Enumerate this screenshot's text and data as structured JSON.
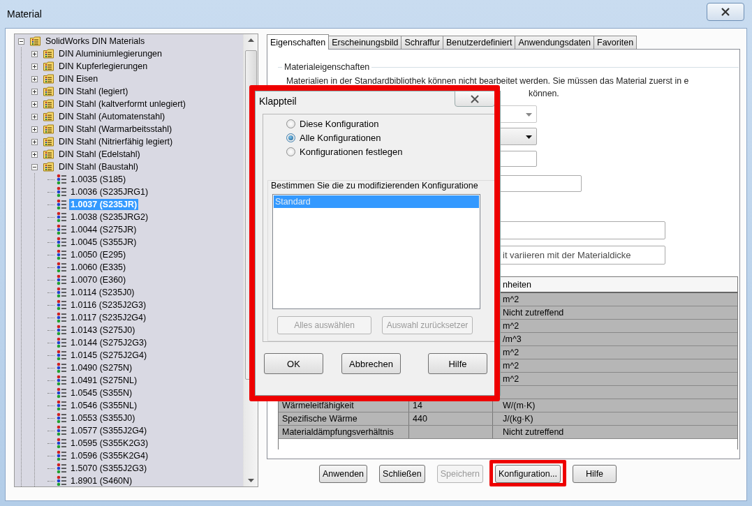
{
  "window": {
    "title": "Material"
  },
  "tree": [
    {
      "label": "SolidWorks DIN Materials",
      "kind": "library",
      "expanded": true,
      "selected": false,
      "children": [
        {
          "label": "DIN Aluminiumlegierungen",
          "kind": "folder",
          "expanded": false,
          "selected": false
        },
        {
          "label": "DIN Kupferlegierungen",
          "kind": "folder",
          "expanded": false,
          "selected": false
        },
        {
          "label": "DIN Eisen",
          "kind": "folder",
          "expanded": false,
          "selected": false
        },
        {
          "label": "DIN Stahl (legiert)",
          "kind": "folder",
          "expanded": false,
          "selected": false
        },
        {
          "label": "DIN Stahl (kaltverformt unlegiert)",
          "kind": "folder",
          "expanded": false,
          "selected": false
        },
        {
          "label": "DIN Stahl (Automatenstahl)",
          "kind": "folder",
          "expanded": false,
          "selected": false
        },
        {
          "label": "DIN Stahl (Warmarbeitsstahl)",
          "kind": "folder",
          "expanded": false,
          "selected": false
        },
        {
          "label": "DIN Stahl (Nitrierfähig legiert)",
          "kind": "folder",
          "expanded": false,
          "selected": false
        },
        {
          "label": "DIN Stahl (Edelstahl)",
          "kind": "folder",
          "expanded": false,
          "selected": false
        },
        {
          "label": "DIN Stahl (Baustahl)",
          "kind": "folder",
          "expanded": true,
          "selected": false,
          "children": [
            {
              "label": "1.0035 (S185)",
              "kind": "material",
              "selected": false
            },
            {
              "label": "1.0036 (S235JRG1)",
              "kind": "material",
              "selected": false
            },
            {
              "label": "1.0037 (S235JR)",
              "kind": "material",
              "selected": true
            },
            {
              "label": "1.0038 (S235JRG2)",
              "kind": "material",
              "selected": false
            },
            {
              "label": "1.0044 (S275JR)",
              "kind": "material",
              "selected": false
            },
            {
              "label": "1.0045 (S355JR)",
              "kind": "material",
              "selected": false
            },
            {
              "label": "1.0050 (E295)",
              "kind": "material",
              "selected": false
            },
            {
              "label": "1.0060 (E335)",
              "kind": "material",
              "selected": false
            },
            {
              "label": "1.0070 (E360)",
              "kind": "material",
              "selected": false
            },
            {
              "label": "1.0114 (S235J0)",
              "kind": "material",
              "selected": false
            },
            {
              "label": "1.0116 (S235J2G3)",
              "kind": "material",
              "selected": false
            },
            {
              "label": "1.0117 (S235J2G4)",
              "kind": "material",
              "selected": false
            },
            {
              "label": "1.0143 (S275J0)",
              "kind": "material",
              "selected": false
            },
            {
              "label": "1.0144 (S275J2G3)",
              "kind": "material",
              "selected": false
            },
            {
              "label": "1.0145 (S275J2G4)",
              "kind": "material",
              "selected": false
            },
            {
              "label": "1.0490 (S275N)",
              "kind": "material",
              "selected": false
            },
            {
              "label": "1.0491 (S275NL)",
              "kind": "material",
              "selected": false
            },
            {
              "label": "1.0545 (S355N)",
              "kind": "material",
              "selected": false
            },
            {
              "label": "1.0546 (S355NL)",
              "kind": "material",
              "selected": false
            },
            {
              "label": "1.0553 (S355J0)",
              "kind": "material",
              "selected": false
            },
            {
              "label": "1.0577 (S355J2G4)",
              "kind": "material",
              "selected": false
            },
            {
              "label": "1.0595 (S355K2G3)",
              "kind": "material",
              "selected": false
            },
            {
              "label": "1.0596 (S355K2G4)",
              "kind": "material",
              "selected": false
            },
            {
              "label": "1.5070 (S355J2G3)",
              "kind": "material",
              "selected": false
            },
            {
              "label": "1.8901 (S460N)",
              "kind": "material",
              "selected": false
            }
          ]
        }
      ]
    }
  ],
  "tabs": [
    {
      "label": "Eigenschaften",
      "selected": true
    },
    {
      "label": "Erscheinungsbild",
      "selected": false
    },
    {
      "label": "Schraffur",
      "selected": false
    },
    {
      "label": "Benutzerdefiniert",
      "selected": false
    },
    {
      "label": "Anwendungsdaten",
      "selected": false
    },
    {
      "label": "Favoriten",
      "selected": false
    }
  ],
  "properties": {
    "group_title": "Materialeigenschaften",
    "notice_lines": [
      "Materialien in der Standardbibliothek können nicht bearbeitet werden. Sie müssen das Material zuerst in e",
      "können."
    ],
    "fields": [
      {
        "kind": "dropdown",
        "disabled": true
      },
      {
        "kind": "dropdown",
        "disabled": false
      },
      {
        "kind": "field"
      },
      {
        "kind": "field"
      },
      {
        "kind": "field"
      },
      {
        "kind": "field",
        "value": "it variieren mit der Materialdicke"
      }
    ],
    "table": {
      "header": "nheiten",
      "rows": [
        {
          "unit": "m^2"
        },
        {
          "unit": "Nicht zutreffend"
        },
        {
          "unit": "m^2"
        },
        {
          "unit": "/m^3"
        },
        {
          "unit": "m^2"
        },
        {
          "unit": "m^2"
        },
        {
          "unit": "m^2"
        },
        {},
        {
          "property": "Wärmeleitfähigkeit",
          "value": "14",
          "unit": "W/(m·K)"
        },
        {
          "property": "Spezifische Wärme",
          "value": "440",
          "unit": "J/(kg·K)"
        },
        {
          "property": "Materialdämpfungsverhältnis",
          "unit": "Nicht zutreffend"
        }
      ]
    }
  },
  "buttons": [
    {
      "label": "Anwenden",
      "disabled": false,
      "highlighted": false
    },
    {
      "label": "Schließen",
      "disabled": false,
      "highlighted": false
    },
    {
      "label": "Speichern",
      "disabled": true,
      "highlighted": false
    },
    {
      "label": "Konfiguration...",
      "disabled": false,
      "highlighted": true
    },
    {
      "label": "Hilfe",
      "disabled": false,
      "highlighted": false
    }
  ],
  "dialog": {
    "title": "Klappteil",
    "highlighted": true,
    "options": [
      {
        "label": "Diese Konfiguration",
        "selected": false
      },
      {
        "label": "Alle Konfigurationen",
        "selected": true
      },
      {
        "label": "Konfigurationen festlegen",
        "selected": false
      }
    ],
    "list_label": "Bestimmen Sie die zu modifizierenden Konfiguratione",
    "list_items": [
      {
        "label": "Standard",
        "selected": true
      }
    ],
    "list_buttons": [
      {
        "label": "Alles auswählen",
        "disabled": true
      },
      {
        "label": "Auswahl zurücksetzer",
        "disabled": true
      }
    ],
    "buttons": [
      {
        "label": "OK"
      },
      {
        "label": "Abbrechen"
      },
      {
        "label": "Hilfe"
      }
    ]
  }
}
